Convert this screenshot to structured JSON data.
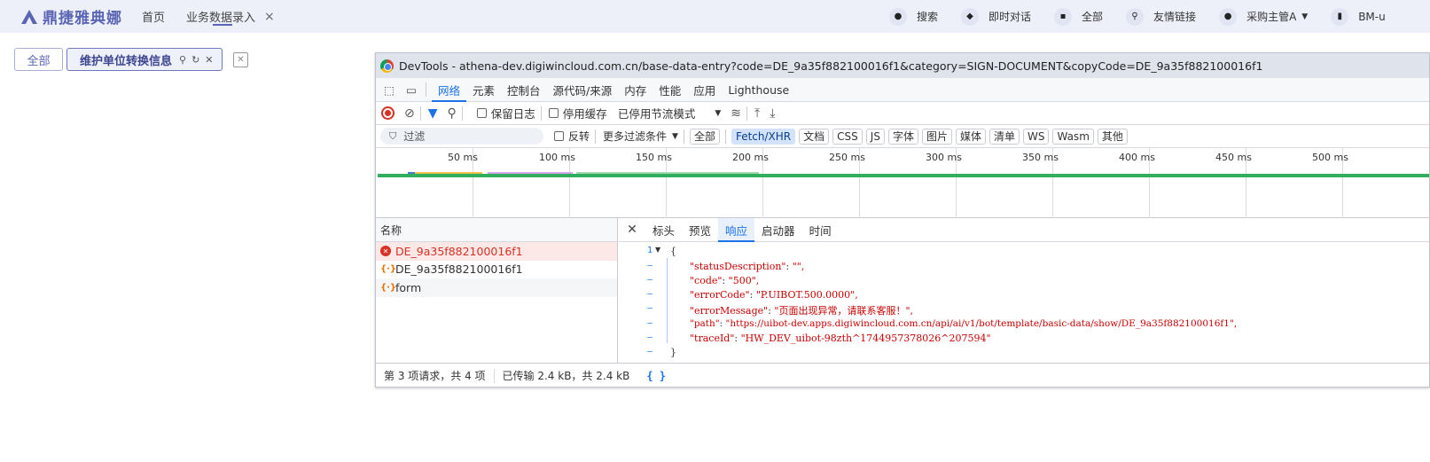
{
  "app": {
    "logo_text": "鼎捷雅典娜",
    "nav": {
      "home": "首页",
      "entry": "业务数据录入",
      "close": "×"
    },
    "header_right": [
      {
        "name": "search",
        "icon": "search-icon",
        "label": "搜索"
      },
      {
        "name": "chat",
        "icon": "chat-icon",
        "label": "即时对话"
      },
      {
        "name": "all",
        "icon": "grid-icon",
        "label": "全部"
      },
      {
        "name": "links",
        "icon": "link-icon",
        "label": "友情链接"
      },
      {
        "name": "user",
        "icon": "user-icon",
        "label": "采购主管A"
      },
      {
        "name": "org",
        "icon": "building-icon",
        "label": "BM-u"
      }
    ]
  },
  "page_tabs": {
    "all": "全部",
    "active": "维护单位转换信息"
  },
  "devtools": {
    "title": "DevTools - athena-dev.digiwincloud.com.cn/base-data-entry?code=DE_9a35f882100016f1&category=SIGN-DOCUMENT&copyCode=DE_9a35f882100016f1",
    "tabs": [
      "网络",
      "元素",
      "控制台",
      "源代码/来源",
      "内存",
      "性能",
      "应用",
      "Lighthouse"
    ],
    "active_tab": "网络",
    "toolbar": {
      "preserve_log": "保留日志",
      "disable_cache": "停用缓存",
      "throttle": "已停用节流模式"
    },
    "filter": {
      "placeholder": "过滤",
      "invert": "反转",
      "more": "更多过滤条件",
      "chips": [
        "全部",
        "Fetch/XHR",
        "文档",
        "CSS",
        "JS",
        "字体",
        "图片",
        "媒体",
        "清单",
        "WS",
        "Wasm",
        "其他"
      ],
      "active_chip": "Fetch/XHR"
    },
    "timeline_ticks": [
      "50 ms",
      "100 ms",
      "150 ms",
      "200 ms",
      "250 ms",
      "300 ms",
      "350 ms",
      "400 ms",
      "450 ms",
      "500 ms"
    ],
    "requests_header": "名称",
    "requests": [
      {
        "name": "DE_9a35f882100016f1",
        "status": "error"
      },
      {
        "name": "DE_9a35f882100016f1",
        "status": "xhr"
      },
      {
        "name": "form",
        "status": "xhr"
      }
    ],
    "detail_tabs": [
      "标头",
      "预览",
      "响应",
      "启动器",
      "时间"
    ],
    "active_detail_tab": "响应",
    "response_lines": [
      {
        "gutter": "1",
        "text": "{"
      },
      {
        "gutter": "–",
        "key": "\"statusDescription\"",
        "value": "\"\","
      },
      {
        "gutter": "–",
        "key": "\"code\"",
        "value": "\"500\","
      },
      {
        "gutter": "–",
        "key": "\"errorCode\"",
        "value": "\"P.UIBOT.500.0000\","
      },
      {
        "gutter": "–",
        "key": "\"errorMessage\"",
        "value": "\"页面出现异常，请联系客服！\","
      },
      {
        "gutter": "–",
        "key": "\"path\"",
        "value": "\"https://uibot-dev.apps.digiwincloud.com.cn/api/ai/v1/bot/template/basic-data/show/DE_9a35f882100016f1\","
      },
      {
        "gutter": "–",
        "key": "\"traceId\"",
        "value": "\"HW_DEV_uibot-98zth^1744957378026^207594\""
      },
      {
        "gutter": "–",
        "text": "}"
      }
    ],
    "status_bar": {
      "requests": "第 3 项请求，共 4 项",
      "transferred": "已传输 2.4 kB，共 2.4 kB",
      "brace": "{ }"
    }
  }
}
